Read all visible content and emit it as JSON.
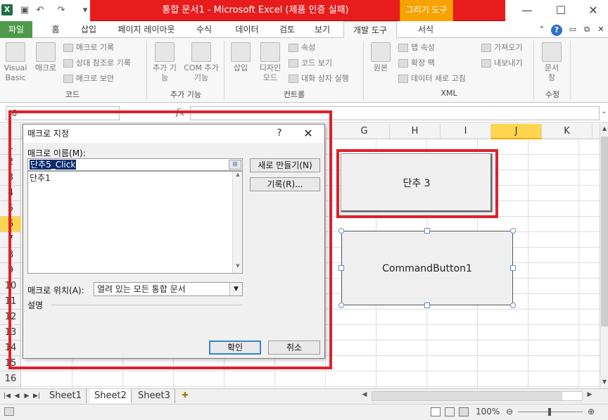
{
  "window": {
    "title": "통합 문서1 - Microsoft Excel (제품 인증 실패)",
    "context_tab": "그리기 도구",
    "logo": "X"
  },
  "ribbon": {
    "tabs": [
      "파일",
      "홈",
      "삽입",
      "페이지 레이아웃",
      "수식",
      "데이터",
      "검토",
      "보기",
      "개발 도구",
      "서식"
    ],
    "active_tab": "개발 도구",
    "groups": {
      "code": {
        "label": "코드",
        "visual_basic": "Visual Basic",
        "macro": "매크로",
        "record_macro": "매크로 기록",
        "relative_ref": "상대 참조로 기록",
        "macro_security": "매크로 보안"
      },
      "addins": {
        "label": "추가 기능",
        "addins": "추가 기능",
        "com_addins": "COM 추가 기능"
      },
      "controls": {
        "label": "컨트롤",
        "insert": "삽입",
        "design_mode": "디자인 모드",
        "properties": "속성",
        "view_code": "코드 보기",
        "run_dialog": "대화 상자 실행"
      },
      "xml": {
        "label": "XML",
        "source": "원본",
        "map_properties": "맵 속성",
        "expansion_packs": "확장 팩",
        "refresh_data": "데이터 새로 고침",
        "import": "가져오기",
        "export": "내보내기"
      },
      "modify": {
        "label": "수정",
        "doc_panel": "문서 창"
      }
    }
  },
  "formula_bar": {
    "name_box": "J6",
    "fx": "fx",
    "value": ""
  },
  "grid": {
    "columns": [
      "G",
      "H",
      "I",
      "J",
      "K"
    ],
    "selected_column": "J",
    "rows": [
      "1",
      "2",
      "3",
      "4",
      "5",
      "6",
      "7",
      "8",
      "9",
      "10",
      "11",
      "12",
      "13",
      "14",
      "15",
      "16"
    ],
    "selected_row": "6"
  },
  "sheet": {
    "form_button_label": "단추 3",
    "command_button_label": "CommandButton1"
  },
  "sheet_tabs": [
    "Sheet1",
    "Sheet2",
    "Sheet3"
  ],
  "active_sheet": "Sheet2",
  "status": {
    "zoom": "100%"
  },
  "dialog": {
    "title": "매크로 지정",
    "help": "?",
    "close": "✕",
    "macro_name_label": "매크로 이름(M):",
    "macro_name_value": "단추5_Click",
    "macro_list": [
      "단추1"
    ],
    "new_button": "새로 만들기(N)",
    "record_button": "기록(R)...",
    "location_label": "매크로 위치(A):",
    "location_value": "열려 있는 모든 통합 문서",
    "description_label": "설명",
    "ok_button": "확인",
    "cancel_button": "취소"
  },
  "colors": {
    "title_red": "#e81c1c",
    "context_orange": "#f6a200",
    "file_tab_green": "#4e9a4a",
    "highlight_red": "#e0202a",
    "selection_yellow": "#ffd54f"
  }
}
